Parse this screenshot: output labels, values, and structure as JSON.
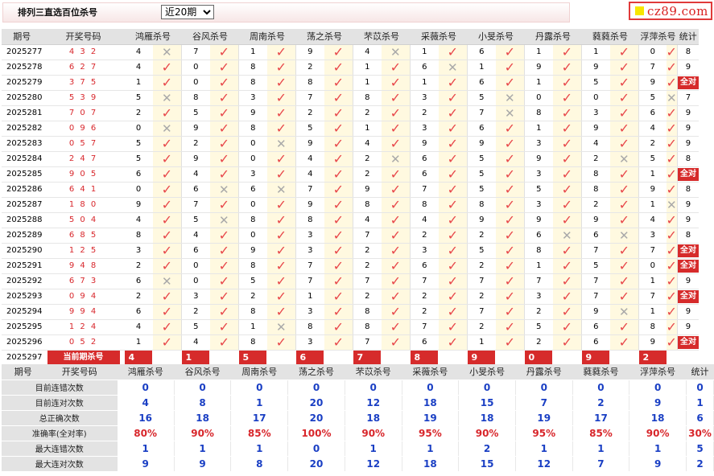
{
  "header": {
    "title": "排列三直选百位杀号",
    "period_select": "近20期",
    "logo_text": "cz89.com"
  },
  "columns": [
    "期号",
    "开奖号码",
    "鸿雁杀号",
    "谷风杀号",
    "周南杀号",
    "荡之杀号",
    "芣苡杀号",
    "采薇杀号",
    "小旻杀号",
    "丹露杀号",
    "蕤蕤杀号",
    "浮萍杀号",
    "统计"
  ],
  "full_label": "全对",
  "rows": [
    {
      "period": "2025277",
      "nums": "4 3 2",
      "kills": [
        "4",
        "7",
        "1",
        "9",
        "4",
        "1",
        "6",
        "1",
        "1",
        "0"
      ],
      "marks": [
        0,
        1,
        1,
        1,
        0,
        1,
        1,
        1,
        1,
        1
      ],
      "stat": "8"
    },
    {
      "period": "2025278",
      "nums": "6 2 7",
      "kills": [
        "4",
        "0",
        "8",
        "2",
        "1",
        "6",
        "1",
        "9",
        "9",
        "7"
      ],
      "marks": [
        1,
        1,
        1,
        1,
        1,
        0,
        1,
        1,
        1,
        1
      ],
      "stat": "9"
    },
    {
      "period": "2025279",
      "nums": "3 7 5",
      "kills": [
        "1",
        "0",
        "8",
        "8",
        "1",
        "1",
        "6",
        "1",
        "5",
        "9"
      ],
      "marks": [
        1,
        1,
        1,
        1,
        1,
        1,
        1,
        1,
        1,
        1
      ],
      "stat": "全对"
    },
    {
      "period": "2025280",
      "nums": "5 3 9",
      "kills": [
        "5",
        "8",
        "3",
        "7",
        "8",
        "3",
        "5",
        "0",
        "0",
        "5"
      ],
      "marks": [
        0,
        1,
        1,
        1,
        1,
        1,
        0,
        1,
        1,
        0
      ],
      "stat": "7"
    },
    {
      "period": "2025281",
      "nums": "7 0 7",
      "kills": [
        "2",
        "5",
        "9",
        "2",
        "2",
        "2",
        "7",
        "8",
        "3",
        "6"
      ],
      "marks": [
        1,
        1,
        1,
        1,
        1,
        1,
        0,
        1,
        1,
        1
      ],
      "stat": "9"
    },
    {
      "period": "2025282",
      "nums": "0 9 6",
      "kills": [
        "0",
        "9",
        "8",
        "5",
        "1",
        "3",
        "6",
        "1",
        "9",
        "4"
      ],
      "marks": [
        0,
        1,
        1,
        1,
        1,
        1,
        1,
        1,
        1,
        1
      ],
      "stat": "9"
    },
    {
      "period": "2025283",
      "nums": "0 5 7",
      "kills": [
        "5",
        "2",
        "0",
        "9",
        "4",
        "9",
        "9",
        "3",
        "4",
        "2"
      ],
      "marks": [
        1,
        1,
        0,
        1,
        1,
        1,
        1,
        1,
        1,
        1
      ],
      "stat": "9"
    },
    {
      "period": "2025284",
      "nums": "2 4 7",
      "kills": [
        "5",
        "9",
        "0",
        "4",
        "2",
        "6",
        "5",
        "9",
        "2",
        "5"
      ],
      "marks": [
        1,
        1,
        1,
        1,
        0,
        1,
        1,
        1,
        0,
        1
      ],
      "stat": "8"
    },
    {
      "period": "2025285",
      "nums": "9 0 5",
      "kills": [
        "6",
        "4",
        "3",
        "4",
        "2",
        "6",
        "5",
        "3",
        "8",
        "1"
      ],
      "marks": [
        1,
        1,
        1,
        1,
        1,
        1,
        1,
        1,
        1,
        1
      ],
      "stat": "全对"
    },
    {
      "period": "2025286",
      "nums": "6 4 1",
      "kills": [
        "0",
        "6",
        "6",
        "7",
        "9",
        "7",
        "5",
        "5",
        "8",
        "9"
      ],
      "marks": [
        1,
        0,
        0,
        1,
        1,
        1,
        1,
        1,
        1,
        1
      ],
      "stat": "8"
    },
    {
      "period": "2025287",
      "nums": "1 8 0",
      "kills": [
        "9",
        "7",
        "0",
        "9",
        "8",
        "8",
        "8",
        "3",
        "2",
        "1"
      ],
      "marks": [
        1,
        1,
        1,
        1,
        1,
        1,
        1,
        1,
        1,
        0
      ],
      "stat": "9"
    },
    {
      "period": "2025288",
      "nums": "5 0 4",
      "kills": [
        "4",
        "5",
        "8",
        "8",
        "4",
        "4",
        "9",
        "9",
        "9",
        "4"
      ],
      "marks": [
        1,
        0,
        1,
        1,
        1,
        1,
        1,
        1,
        1,
        1
      ],
      "stat": "9"
    },
    {
      "period": "2025289",
      "nums": "6 8 5",
      "kills": [
        "8",
        "4",
        "0",
        "3",
        "7",
        "2",
        "2",
        "6",
        "6",
        "3"
      ],
      "marks": [
        1,
        1,
        1,
        1,
        1,
        1,
        1,
        0,
        0,
        1
      ],
      "stat": "8"
    },
    {
      "period": "2025290",
      "nums": "1 2 5",
      "kills": [
        "3",
        "6",
        "9",
        "3",
        "2",
        "3",
        "5",
        "8",
        "7",
        "7"
      ],
      "marks": [
        1,
        1,
        1,
        1,
        1,
        1,
        1,
        1,
        1,
        1
      ],
      "stat": "全对"
    },
    {
      "period": "2025291",
      "nums": "9 4 8",
      "kills": [
        "2",
        "0",
        "8",
        "7",
        "2",
        "6",
        "2",
        "1",
        "5",
        "0"
      ],
      "marks": [
        1,
        1,
        1,
        1,
        1,
        1,
        1,
        1,
        1,
        1
      ],
      "stat": "全对"
    },
    {
      "period": "2025292",
      "nums": "6 7 3",
      "kills": [
        "6",
        "0",
        "5",
        "7",
        "7",
        "7",
        "7",
        "7",
        "7",
        "1"
      ],
      "marks": [
        0,
        1,
        1,
        1,
        1,
        1,
        1,
        1,
        1,
        1
      ],
      "stat": "9"
    },
    {
      "period": "2025293",
      "nums": "0 9 4",
      "kills": [
        "2",
        "3",
        "2",
        "1",
        "2",
        "2",
        "2",
        "3",
        "7",
        "7"
      ],
      "marks": [
        1,
        1,
        1,
        1,
        1,
        1,
        1,
        1,
        1,
        1
      ],
      "stat": "全对"
    },
    {
      "period": "2025294",
      "nums": "9 9 4",
      "kills": [
        "6",
        "2",
        "8",
        "3",
        "8",
        "2",
        "7",
        "2",
        "9",
        "1"
      ],
      "marks": [
        1,
        1,
        1,
        1,
        1,
        1,
        1,
        1,
        0,
        1
      ],
      "stat": "9"
    },
    {
      "period": "2025295",
      "nums": "1 2 4",
      "kills": [
        "4",
        "5",
        "1",
        "8",
        "8",
        "7",
        "2",
        "5",
        "6",
        "8"
      ],
      "marks": [
        1,
        1,
        0,
        1,
        1,
        1,
        1,
        1,
        1,
        1
      ],
      "stat": "9"
    },
    {
      "period": "2025296",
      "nums": "0 5 2",
      "kills": [
        "1",
        "4",
        "8",
        "3",
        "7",
        "6",
        "1",
        "2",
        "6",
        "9"
      ],
      "marks": [
        1,
        1,
        1,
        1,
        1,
        1,
        1,
        1,
        1,
        1
      ],
      "stat": "全对"
    }
  ],
  "current": {
    "period": "2025297",
    "label": "当前期杀号",
    "kills": [
      "4",
      "1",
      "5",
      "6",
      "7",
      "8",
      "9",
      "0",
      "9",
      "2"
    ]
  },
  "stats": {
    "header": [
      "期号",
      "开奖号码",
      "鸿雁杀号",
      "谷风杀号",
      "周南杀号",
      "荡之杀号",
      "芣苡杀号",
      "采薇杀号",
      "小旻杀号",
      "丹露杀号",
      "蕤蕤杀号",
      "浮萍杀号",
      "统计"
    ],
    "rows": [
      {
        "label": "目前连错次数",
        "values": [
          "0",
          "0",
          "0",
          "0",
          "0",
          "0",
          "0",
          "0",
          "0",
          "0",
          "0"
        ],
        "red": false
      },
      {
        "label": "目前连对次数",
        "values": [
          "4",
          "8",
          "1",
          "20",
          "12",
          "18",
          "15",
          "7",
          "2",
          "9",
          "1"
        ],
        "red": false
      },
      {
        "label": "总正确次数",
        "values": [
          "16",
          "18",
          "17",
          "20",
          "18",
          "19",
          "18",
          "19",
          "17",
          "18",
          "6"
        ],
        "red": false
      },
      {
        "label": "准确率(全对率)",
        "values": [
          "80%",
          "90%",
          "85%",
          "100%",
          "90%",
          "95%",
          "90%",
          "95%",
          "85%",
          "90%",
          "30%"
        ],
        "red": true
      },
      {
        "label": "最大连错次数",
        "values": [
          "1",
          "1",
          "1",
          "0",
          "1",
          "1",
          "2",
          "1",
          "1",
          "1",
          "5"
        ],
        "red": false
      },
      {
        "label": "最大连对次数",
        "values": [
          "9",
          "9",
          "8",
          "20",
          "12",
          "18",
          "15",
          "12",
          "7",
          "9",
          "2"
        ],
        "red": false
      }
    ]
  }
}
